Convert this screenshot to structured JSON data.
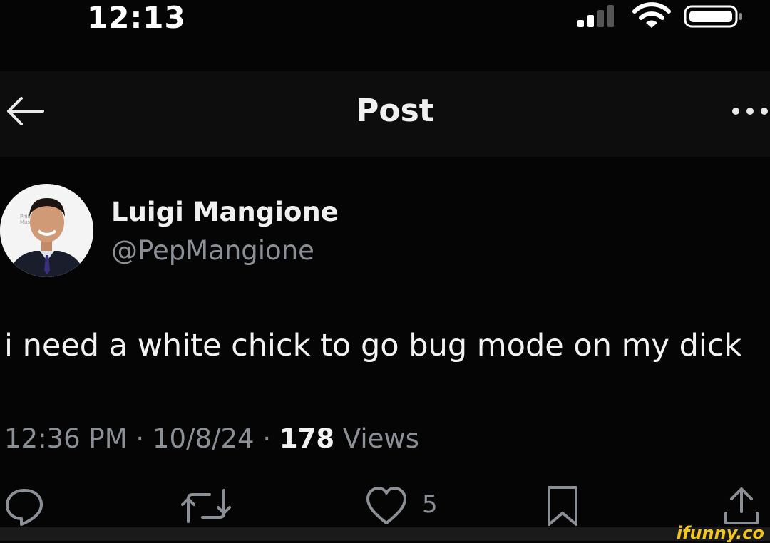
{
  "status": {
    "time": "12:13"
  },
  "nav": {
    "title": "Post"
  },
  "post": {
    "author_name": "Luigi Mangione",
    "author_handle": "@PepMangione",
    "text": "i need a white chick to go bug mode on my dick",
    "time": "12:36 PM",
    "date": "10/8/24",
    "separator": "·",
    "views_count": "178",
    "views_label": "Views"
  },
  "actions": {
    "like_count": "5"
  },
  "watermark": {
    "text": "ifunny.co"
  },
  "colors": {
    "background": "#050505",
    "secondary_text": "#8b9096",
    "watermark": "#f2c51c"
  }
}
